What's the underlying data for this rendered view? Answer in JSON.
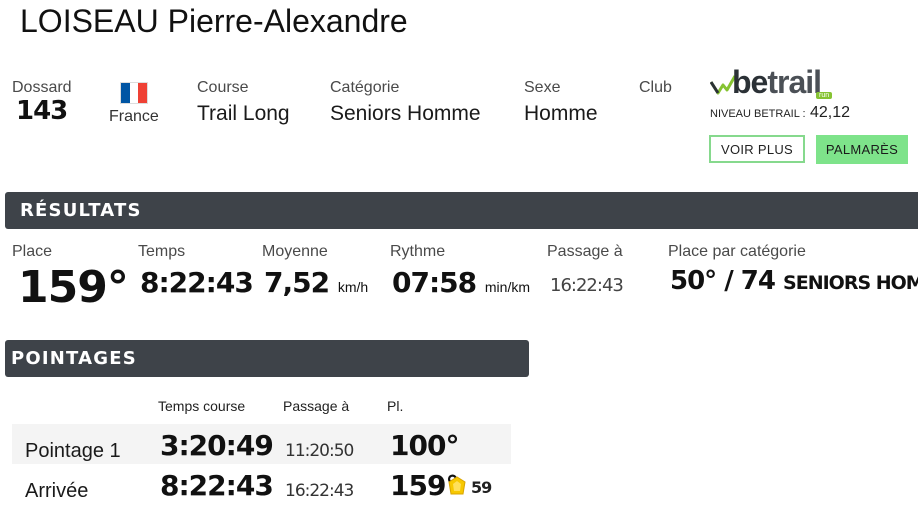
{
  "runner": {
    "name": "LOISEAU Pierre-Alexandre"
  },
  "info": {
    "dossard_label": "Dossard",
    "dossard_value": "143",
    "country": "France",
    "country_flag_icon": "france-flag-icon",
    "course_label": "Course",
    "course_value": "Trail Long",
    "categorie_label": "Catégorie",
    "categorie_value": "Seniors Homme",
    "sexe_label": "Sexe",
    "sexe_value": "Homme",
    "club_label": "Club",
    "betrail": {
      "logo_text_be": "be",
      "logo_text_trail": "trail",
      "logo_sub": "run",
      "niveau_label": "NIVEAU BETRAIL :",
      "niveau_value": "42,12"
    }
  },
  "buttons": {
    "voir_plus": "VOIR PLUS",
    "palmares": "PALMARÈS"
  },
  "results": {
    "title": "RÉSULTATS",
    "place_label": "Place",
    "place_value": "159°",
    "temps_label": "Temps",
    "temps_value": "8:22:43",
    "moyenne_label": "Moyenne",
    "moyenne_value": "7,52",
    "moyenne_unit": "km/h",
    "rythme_label": "Rythme",
    "rythme_value": "07:58",
    "rythme_unit": "min/km",
    "passage_label": "Passage à",
    "passage_value": "16:22:43",
    "place_cat_label": "Place par catégorie",
    "place_cat_value": "50° / 74",
    "place_cat_name": "SENIORS HOMME"
  },
  "pointages": {
    "title": "POINTAGES",
    "headers": {
      "temps": "Temps course",
      "passage": "Passage à",
      "place": "Pl."
    },
    "rows": [
      {
        "name": "Pointage 1",
        "temps": "3:20:49",
        "passage": "11:20:50",
        "place": "100°"
      },
      {
        "name": "Arrivée",
        "temps": "8:22:43",
        "passage": "16:22:43",
        "place": "159°",
        "badge_icon": "medal-icon",
        "badge_value": "59"
      }
    ]
  },
  "colors": {
    "header_bar": "#3e4349",
    "accent_green": "#7ee38a",
    "flag_blue": "#0055a4",
    "flag_red": "#ef4135"
  }
}
